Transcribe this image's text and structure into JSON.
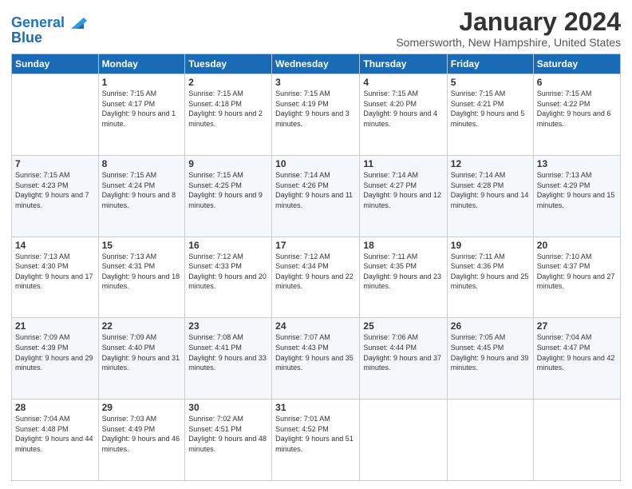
{
  "logo": {
    "text_general": "General",
    "text_blue": "Blue"
  },
  "title": "January 2024",
  "subtitle": "Somersworth, New Hampshire, United States",
  "weekdays": [
    "Sunday",
    "Monday",
    "Tuesday",
    "Wednesday",
    "Thursday",
    "Friday",
    "Saturday"
  ],
  "weeks": [
    [
      {
        "day": "",
        "sunrise": "",
        "sunset": "",
        "daylight": ""
      },
      {
        "day": "1",
        "sunrise": "Sunrise: 7:15 AM",
        "sunset": "Sunset: 4:17 PM",
        "daylight": "Daylight: 9 hours and 1 minute."
      },
      {
        "day": "2",
        "sunrise": "Sunrise: 7:15 AM",
        "sunset": "Sunset: 4:18 PM",
        "daylight": "Daylight: 9 hours and 2 minutes."
      },
      {
        "day": "3",
        "sunrise": "Sunrise: 7:15 AM",
        "sunset": "Sunset: 4:19 PM",
        "daylight": "Daylight: 9 hours and 3 minutes."
      },
      {
        "day": "4",
        "sunrise": "Sunrise: 7:15 AM",
        "sunset": "Sunset: 4:20 PM",
        "daylight": "Daylight: 9 hours and 4 minutes."
      },
      {
        "day": "5",
        "sunrise": "Sunrise: 7:15 AM",
        "sunset": "Sunset: 4:21 PM",
        "daylight": "Daylight: 9 hours and 5 minutes."
      },
      {
        "day": "6",
        "sunrise": "Sunrise: 7:15 AM",
        "sunset": "Sunset: 4:22 PM",
        "daylight": "Daylight: 9 hours and 6 minutes."
      }
    ],
    [
      {
        "day": "7",
        "sunrise": "Sunrise: 7:15 AM",
        "sunset": "Sunset: 4:23 PM",
        "daylight": "Daylight: 9 hours and 7 minutes."
      },
      {
        "day": "8",
        "sunrise": "Sunrise: 7:15 AM",
        "sunset": "Sunset: 4:24 PM",
        "daylight": "Daylight: 9 hours and 8 minutes."
      },
      {
        "day": "9",
        "sunrise": "Sunrise: 7:15 AM",
        "sunset": "Sunset: 4:25 PM",
        "daylight": "Daylight: 9 hours and 9 minutes."
      },
      {
        "day": "10",
        "sunrise": "Sunrise: 7:14 AM",
        "sunset": "Sunset: 4:26 PM",
        "daylight": "Daylight: 9 hours and 11 minutes."
      },
      {
        "day": "11",
        "sunrise": "Sunrise: 7:14 AM",
        "sunset": "Sunset: 4:27 PM",
        "daylight": "Daylight: 9 hours and 12 minutes."
      },
      {
        "day": "12",
        "sunrise": "Sunrise: 7:14 AM",
        "sunset": "Sunset: 4:28 PM",
        "daylight": "Daylight: 9 hours and 14 minutes."
      },
      {
        "day": "13",
        "sunrise": "Sunrise: 7:13 AM",
        "sunset": "Sunset: 4:29 PM",
        "daylight": "Daylight: 9 hours and 15 minutes."
      }
    ],
    [
      {
        "day": "14",
        "sunrise": "Sunrise: 7:13 AM",
        "sunset": "Sunset: 4:30 PM",
        "daylight": "Daylight: 9 hours and 17 minutes."
      },
      {
        "day": "15",
        "sunrise": "Sunrise: 7:13 AM",
        "sunset": "Sunset: 4:31 PM",
        "daylight": "Daylight: 9 hours and 18 minutes."
      },
      {
        "day": "16",
        "sunrise": "Sunrise: 7:12 AM",
        "sunset": "Sunset: 4:33 PM",
        "daylight": "Daylight: 9 hours and 20 minutes."
      },
      {
        "day": "17",
        "sunrise": "Sunrise: 7:12 AM",
        "sunset": "Sunset: 4:34 PM",
        "daylight": "Daylight: 9 hours and 22 minutes."
      },
      {
        "day": "18",
        "sunrise": "Sunrise: 7:11 AM",
        "sunset": "Sunset: 4:35 PM",
        "daylight": "Daylight: 9 hours and 23 minutes."
      },
      {
        "day": "19",
        "sunrise": "Sunrise: 7:11 AM",
        "sunset": "Sunset: 4:36 PM",
        "daylight": "Daylight: 9 hours and 25 minutes."
      },
      {
        "day": "20",
        "sunrise": "Sunrise: 7:10 AM",
        "sunset": "Sunset: 4:37 PM",
        "daylight": "Daylight: 9 hours and 27 minutes."
      }
    ],
    [
      {
        "day": "21",
        "sunrise": "Sunrise: 7:09 AM",
        "sunset": "Sunset: 4:39 PM",
        "daylight": "Daylight: 9 hours and 29 minutes."
      },
      {
        "day": "22",
        "sunrise": "Sunrise: 7:09 AM",
        "sunset": "Sunset: 4:40 PM",
        "daylight": "Daylight: 9 hours and 31 minutes."
      },
      {
        "day": "23",
        "sunrise": "Sunrise: 7:08 AM",
        "sunset": "Sunset: 4:41 PM",
        "daylight": "Daylight: 9 hours and 33 minutes."
      },
      {
        "day": "24",
        "sunrise": "Sunrise: 7:07 AM",
        "sunset": "Sunset: 4:43 PM",
        "daylight": "Daylight: 9 hours and 35 minutes."
      },
      {
        "day": "25",
        "sunrise": "Sunrise: 7:06 AM",
        "sunset": "Sunset: 4:44 PM",
        "daylight": "Daylight: 9 hours and 37 minutes."
      },
      {
        "day": "26",
        "sunrise": "Sunrise: 7:05 AM",
        "sunset": "Sunset: 4:45 PM",
        "daylight": "Daylight: 9 hours and 39 minutes."
      },
      {
        "day": "27",
        "sunrise": "Sunrise: 7:04 AM",
        "sunset": "Sunset: 4:47 PM",
        "daylight": "Daylight: 9 hours and 42 minutes."
      }
    ],
    [
      {
        "day": "28",
        "sunrise": "Sunrise: 7:04 AM",
        "sunset": "Sunset: 4:48 PM",
        "daylight": "Daylight: 9 hours and 44 minutes."
      },
      {
        "day": "29",
        "sunrise": "Sunrise: 7:03 AM",
        "sunset": "Sunset: 4:49 PM",
        "daylight": "Daylight: 9 hours and 46 minutes."
      },
      {
        "day": "30",
        "sunrise": "Sunrise: 7:02 AM",
        "sunset": "Sunset: 4:51 PM",
        "daylight": "Daylight: 9 hours and 48 minutes."
      },
      {
        "day": "31",
        "sunrise": "Sunrise: 7:01 AM",
        "sunset": "Sunset: 4:52 PM",
        "daylight": "Daylight: 9 hours and 51 minutes."
      },
      {
        "day": "",
        "sunrise": "",
        "sunset": "",
        "daylight": ""
      },
      {
        "day": "",
        "sunrise": "",
        "sunset": "",
        "daylight": ""
      },
      {
        "day": "",
        "sunrise": "",
        "sunset": "",
        "daylight": ""
      }
    ]
  ]
}
